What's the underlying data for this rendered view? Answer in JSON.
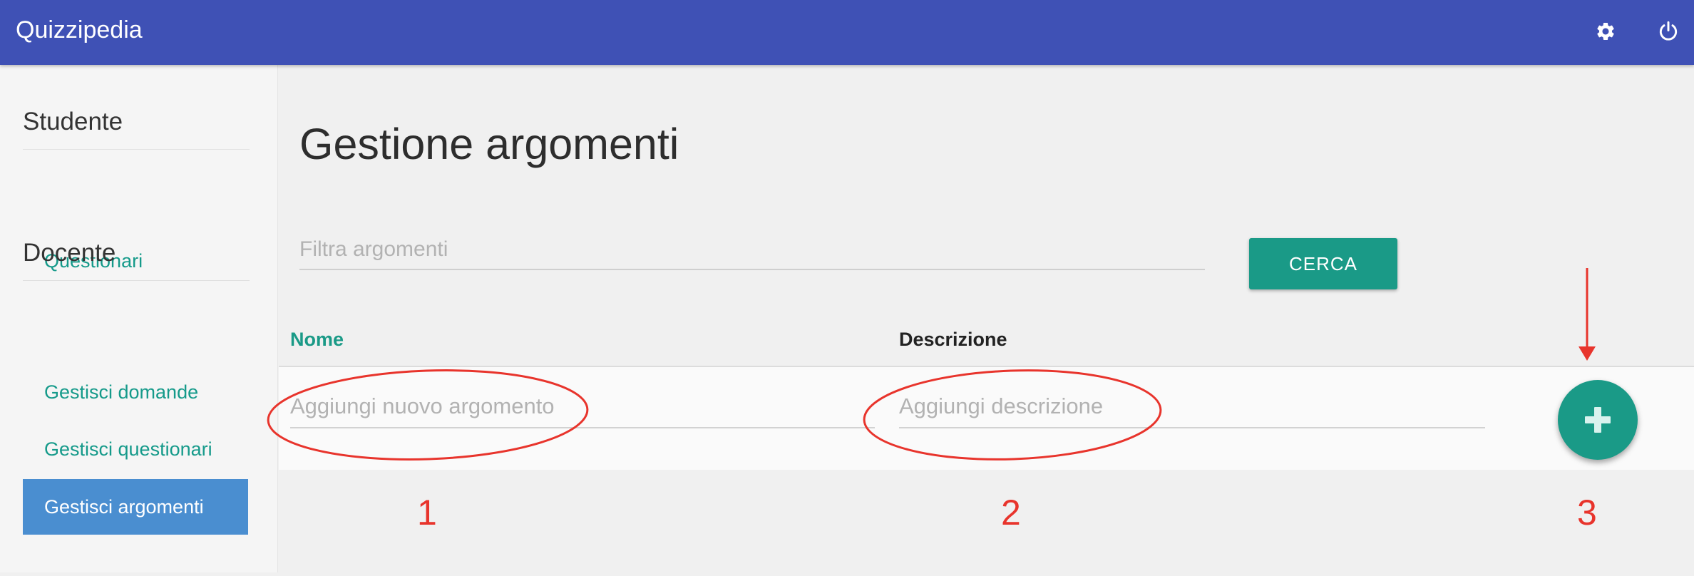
{
  "app": {
    "title": "Quizzipedia"
  },
  "header": {
    "icons": [
      "gear-icon",
      "power-icon"
    ]
  },
  "sidebar": {
    "sections": [
      {
        "title": "Studente",
        "items": [
          {
            "label": "Questionari",
            "active": false
          }
        ]
      },
      {
        "title": "Docente",
        "items": [
          {
            "label": "Gestisci domande",
            "active": false
          },
          {
            "label": "Gestisci questionari",
            "active": false
          },
          {
            "label": "Gestisci argomenti",
            "active": true
          }
        ]
      }
    ]
  },
  "main": {
    "title": "Gestione argomenti",
    "filter": {
      "placeholder": "Filtra argomenti",
      "value": ""
    },
    "search_button": "CERCA",
    "table": {
      "columns": [
        "Nome",
        "Descrizione"
      ],
      "new_row": {
        "name_placeholder": "Aggiungi nuovo argomento",
        "description_placeholder": "Aggiungi descrizione",
        "add_icon": "plus-icon"
      }
    }
  },
  "annotations": {
    "labels": [
      "1",
      "2",
      "3"
    ],
    "color": "#e8342c"
  },
  "colors": {
    "header": "#3f51b5",
    "accent": "#1a9a87",
    "active_item": "#4a8ed0"
  }
}
